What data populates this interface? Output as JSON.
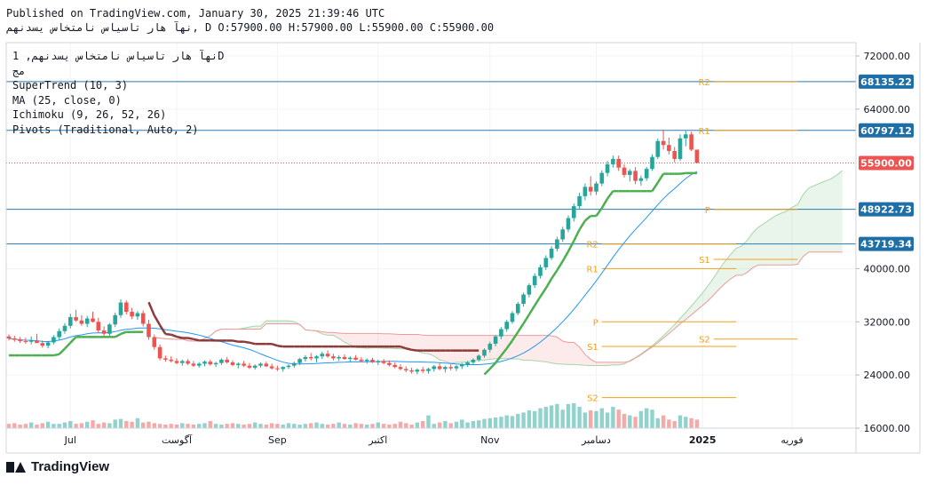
{
  "header": {
    "published": "Published on TradingView.com, January 30, 2025 21:39:46 UTC",
    "ohlc_line": "نهآ هار تاسیاس نامتخاس یسدنهم, D O:57900.00 H:57900.00 L:55900.00 C:55900.00"
  },
  "legend": {
    "symbol": "نهآ هار تاسیاس نامتخاس یسدنهم, 1D",
    "exchange": "مج",
    "supertrend": "SuperTrend (10, 3)",
    "ma": "MA (25, close, 0)",
    "ichimoku": "Ichimoku (9, 26, 52, 26)",
    "pivots": "Pivots (Traditional, Auto, 2)"
  },
  "brand": {
    "name": "TradingView"
  },
  "colors": {
    "up": "#26a69a",
    "down": "#ef5350",
    "supertrend_up": "#4caf50",
    "supertrend_down": "#8d3a3a",
    "ma": "#2196f3",
    "pivot": "#f59f1a",
    "hline": "#2a7ab0",
    "last_price": "#ef5350"
  },
  "chart_data": {
    "type": "candlestick",
    "x_ticks": [
      "Jul",
      "آگوست",
      "Sep",
      "اکتبر",
      "Nov",
      "دسامبر",
      "2025",
      "فوریه"
    ],
    "y_ticks": [
      "72000.00",
      "64000.00",
      "40000.00",
      "32000.00",
      "24000.00",
      "16000.00"
    ],
    "ylim": [
      16000,
      74000
    ],
    "price_tags": [
      {
        "label": "68135.22",
        "value": 68135.22,
        "kind": "hline"
      },
      {
        "label": "60797.12",
        "value": 60797.12,
        "kind": "hline"
      },
      {
        "label": "55900.00",
        "value": 55900.0,
        "kind": "last"
      },
      {
        "label": "48922.73",
        "value": 48922.73,
        "kind": "hline"
      },
      {
        "label": "43719.34",
        "value": 43719.34,
        "kind": "hline"
      }
    ],
    "pivot_sets": [
      {
        "from": "دسامبر",
        "levels": [
          {
            "label": "R2",
            "value": 43700
          },
          {
            "label": "R1",
            "value": 40000
          },
          {
            "label": "P",
            "value": 32000
          },
          {
            "label": "S1",
            "value": 28300
          },
          {
            "label": "S2",
            "value": 20600
          }
        ]
      },
      {
        "from": "2025",
        "levels": [
          {
            "label": "R2",
            "value": 68100
          },
          {
            "label": "R1",
            "value": 60800
          },
          {
            "label": "P",
            "value": 48900
          },
          {
            "label": "S1",
            "value": 41400
          },
          {
            "label": "S2",
            "value": 29400
          }
        ]
      }
    ],
    "candles": [
      {
        "o": 29800,
        "h": 30100,
        "l": 29200,
        "c": 29500
      },
      {
        "o": 29500,
        "h": 29900,
        "l": 29000,
        "c": 29300
      },
      {
        "o": 29300,
        "h": 29700,
        "l": 28800,
        "c": 29100
      },
      {
        "o": 29100,
        "h": 29600,
        "l": 28700,
        "c": 29000
      },
      {
        "o": 29000,
        "h": 29800,
        "l": 28600,
        "c": 29200
      },
      {
        "o": 29200,
        "h": 30200,
        "l": 28900,
        "c": 28800
      },
      {
        "o": 28800,
        "h": 29200,
        "l": 28100,
        "c": 28400
      },
      {
        "o": 28400,
        "h": 29000,
        "l": 28000,
        "c": 28900
      },
      {
        "o": 28900,
        "h": 30000,
        "l": 28600,
        "c": 29700
      },
      {
        "o": 29700,
        "h": 31000,
        "l": 29300,
        "c": 30600
      },
      {
        "o": 30600,
        "h": 31800,
        "l": 30200,
        "c": 31400
      },
      {
        "o": 31400,
        "h": 33200,
        "l": 31000,
        "c": 32700
      },
      {
        "o": 32700,
        "h": 33800,
        "l": 32000,
        "c": 32200
      },
      {
        "o": 32200,
        "h": 33000,
        "l": 31400,
        "c": 31700
      },
      {
        "o": 31700,
        "h": 32900,
        "l": 31200,
        "c": 32500
      },
      {
        "o": 32500,
        "h": 33500,
        "l": 31900,
        "c": 32000
      },
      {
        "o": 32000,
        "h": 32600,
        "l": 30300,
        "c": 30700
      },
      {
        "o": 30700,
        "h": 31300,
        "l": 29800,
        "c": 30200
      },
      {
        "o": 30200,
        "h": 31800,
        "l": 29800,
        "c": 31600
      },
      {
        "o": 31600,
        "h": 33400,
        "l": 31200,
        "c": 33000
      },
      {
        "o": 33000,
        "h": 35400,
        "l": 32600,
        "c": 34900
      },
      {
        "o": 34900,
        "h": 35200,
        "l": 33100,
        "c": 33500
      },
      {
        "o": 33500,
        "h": 34100,
        "l": 32400,
        "c": 32800
      },
      {
        "o": 32800,
        "h": 33600,
        "l": 32300,
        "c": 33300
      },
      {
        "o": 33300,
        "h": 33700,
        "l": 31300,
        "c": 31700
      },
      {
        "o": 31700,
        "h": 32300,
        "l": 29300,
        "c": 29700
      },
      {
        "o": 29700,
        "h": 30100,
        "l": 27800,
        "c": 28200
      },
      {
        "o": 28200,
        "h": 28600,
        "l": 26200,
        "c": 26500
      },
      {
        "o": 26500,
        "h": 26900,
        "l": 26000,
        "c": 26300
      },
      {
        "o": 26300,
        "h": 26800,
        "l": 25900,
        "c": 26100
      },
      {
        "o": 26100,
        "h": 26500,
        "l": 25600,
        "c": 25800
      },
      {
        "o": 25800,
        "h": 26300,
        "l": 25400,
        "c": 26100
      },
      {
        "o": 26100,
        "h": 26400,
        "l": 25500,
        "c": 25700
      },
      {
        "o": 25700,
        "h": 26100,
        "l": 25200,
        "c": 25400
      },
      {
        "o": 25400,
        "h": 25900,
        "l": 25100,
        "c": 25700
      },
      {
        "o": 25700,
        "h": 26200,
        "l": 25300,
        "c": 26000
      },
      {
        "o": 26000,
        "h": 26300,
        "l": 25400,
        "c": 25600
      },
      {
        "o": 25600,
        "h": 26000,
        "l": 25200,
        "c": 25800
      },
      {
        "o": 25800,
        "h": 26500,
        "l": 25500,
        "c": 26300
      },
      {
        "o": 26300,
        "h": 26700,
        "l": 25700,
        "c": 25900
      },
      {
        "o": 25900,
        "h": 26200,
        "l": 25300,
        "c": 25500
      },
      {
        "o": 25500,
        "h": 25900,
        "l": 25000,
        "c": 25700
      },
      {
        "o": 25700,
        "h": 26100,
        "l": 25200,
        "c": 25400
      },
      {
        "o": 25400,
        "h": 25800,
        "l": 24900,
        "c": 25100
      },
      {
        "o": 25100,
        "h": 25600,
        "l": 24800,
        "c": 25400
      },
      {
        "o": 25400,
        "h": 25900,
        "l": 25100,
        "c": 25700
      },
      {
        "o": 25700,
        "h": 26000,
        "l": 25200,
        "c": 25300
      },
      {
        "o": 25300,
        "h": 25700,
        "l": 24800,
        "c": 25000
      },
      {
        "o": 25000,
        "h": 25400,
        "l": 24600,
        "c": 24900
      },
      {
        "o": 24900,
        "h": 25300,
        "l": 24500,
        "c": 25200
      },
      {
        "o": 25200,
        "h": 25600,
        "l": 24900,
        "c": 25400
      },
      {
        "o": 25400,
        "h": 26000,
        "l": 25100,
        "c": 25800
      },
      {
        "o": 25800,
        "h": 26600,
        "l": 25500,
        "c": 26400
      },
      {
        "o": 26400,
        "h": 27000,
        "l": 26000,
        "c": 26700
      },
      {
        "o": 26700,
        "h": 27300,
        "l": 26200,
        "c": 26500
      },
      {
        "o": 26500,
        "h": 27000,
        "l": 25900,
        "c": 26800
      },
      {
        "o": 26800,
        "h": 27500,
        "l": 26400,
        "c": 27200
      },
      {
        "o": 27200,
        "h": 27700,
        "l": 26600,
        "c": 26800
      },
      {
        "o": 26800,
        "h": 27200,
        "l": 26200,
        "c": 26500
      },
      {
        "o": 26500,
        "h": 27000,
        "l": 26100,
        "c": 26700
      },
      {
        "o": 26700,
        "h": 27100,
        "l": 26300,
        "c": 26400
      },
      {
        "o": 26400,
        "h": 26800,
        "l": 26000,
        "c": 26600
      },
      {
        "o": 26600,
        "h": 27000,
        "l": 26200,
        "c": 26300
      },
      {
        "o": 26300,
        "h": 26700,
        "l": 25900,
        "c": 26100
      },
      {
        "o": 26100,
        "h": 26500,
        "l": 25700,
        "c": 26300
      },
      {
        "o": 26300,
        "h": 26600,
        "l": 25800,
        "c": 25900
      },
      {
        "o": 25900,
        "h": 26300,
        "l": 25500,
        "c": 26100
      },
      {
        "o": 26100,
        "h": 26400,
        "l": 25600,
        "c": 25800
      },
      {
        "o": 25800,
        "h": 26200,
        "l": 25300,
        "c": 25500
      },
      {
        "o": 25500,
        "h": 25900,
        "l": 25000,
        "c": 25200
      },
      {
        "o": 25200,
        "h": 25600,
        "l": 24700,
        "c": 24900
      },
      {
        "o": 24900,
        "h": 25300,
        "l": 24400,
        "c": 24700
      },
      {
        "o": 24700,
        "h": 25100,
        "l": 24200,
        "c": 24500
      },
      {
        "o": 24500,
        "h": 25000,
        "l": 24100,
        "c": 24800
      },
      {
        "o": 24800,
        "h": 25200,
        "l": 24300,
        "c": 24600
      },
      {
        "o": 24600,
        "h": 25100,
        "l": 24200,
        "c": 24900
      },
      {
        "o": 24900,
        "h": 25500,
        "l": 24500,
        "c": 25300
      },
      {
        "o": 25300,
        "h": 25800,
        "l": 24700,
        "c": 24900
      },
      {
        "o": 24900,
        "h": 25400,
        "l": 24400,
        "c": 25200
      },
      {
        "o": 25200,
        "h": 25600,
        "l": 24700,
        "c": 25000
      },
      {
        "o": 25000,
        "h": 25500,
        "l": 24600,
        "c": 25300
      },
      {
        "o": 25300,
        "h": 25800,
        "l": 24900,
        "c": 25600
      },
      {
        "o": 25600,
        "h": 26100,
        "l": 25200,
        "c": 25900
      },
      {
        "o": 25900,
        "h": 26500,
        "l": 25500,
        "c": 26300
      },
      {
        "o": 26300,
        "h": 27100,
        "l": 26000,
        "c": 26900
      },
      {
        "o": 26900,
        "h": 28000,
        "l": 26600,
        "c": 27800
      },
      {
        "o": 27800,
        "h": 29000,
        "l": 27400,
        "c": 28700
      },
      {
        "o": 28700,
        "h": 30000,
        "l": 28300,
        "c": 29800
      },
      {
        "o": 29800,
        "h": 31200,
        "l": 29400,
        "c": 30900
      },
      {
        "o": 30900,
        "h": 32300,
        "l": 30500,
        "c": 32000
      },
      {
        "o": 32000,
        "h": 33600,
        "l": 31700,
        "c": 33300
      },
      {
        "o": 33300,
        "h": 35000,
        "l": 33000,
        "c": 34700
      },
      {
        "o": 34700,
        "h": 36400,
        "l": 34300,
        "c": 36100
      },
      {
        "o": 36100,
        "h": 37800,
        "l": 35700,
        "c": 37500
      },
      {
        "o": 37500,
        "h": 39300,
        "l": 37100,
        "c": 38900
      },
      {
        "o": 38900,
        "h": 40600,
        "l": 38500,
        "c": 40200
      },
      {
        "o": 40200,
        "h": 42000,
        "l": 39800,
        "c": 41600
      },
      {
        "o": 41600,
        "h": 43400,
        "l": 41300,
        "c": 43000
      },
      {
        "o": 43000,
        "h": 44800,
        "l": 42600,
        "c": 44400
      },
      {
        "o": 44400,
        "h": 46300,
        "l": 44000,
        "c": 45900
      },
      {
        "o": 45900,
        "h": 48000,
        "l": 45500,
        "c": 47600
      },
      {
        "o": 47600,
        "h": 49800,
        "l": 47100,
        "c": 49400
      },
      {
        "o": 49400,
        "h": 51400,
        "l": 48900,
        "c": 50900
      },
      {
        "o": 50900,
        "h": 52800,
        "l": 50300,
        "c": 52300
      },
      {
        "o": 52300,
        "h": 53900,
        "l": 51000,
        "c": 51600
      },
      {
        "o": 51600,
        "h": 53100,
        "l": 51100,
        "c": 52800
      },
      {
        "o": 52800,
        "h": 54800,
        "l": 52400,
        "c": 54400
      },
      {
        "o": 54400,
        "h": 56200,
        "l": 53900,
        "c": 55700
      },
      {
        "o": 55700,
        "h": 57000,
        "l": 55200,
        "c": 56500
      },
      {
        "o": 56500,
        "h": 57000,
        "l": 54700,
        "c": 55200
      },
      {
        "o": 55200,
        "h": 55700,
        "l": 53700,
        "c": 54100
      },
      {
        "o": 54100,
        "h": 55000,
        "l": 53100,
        "c": 54700
      },
      {
        "o": 54700,
        "h": 55300,
        "l": 52700,
        "c": 53200
      },
      {
        "o": 53200,
        "h": 54000,
        "l": 52500,
        "c": 53600
      },
      {
        "o": 53600,
        "h": 55300,
        "l": 53200,
        "c": 55000
      },
      {
        "o": 55000,
        "h": 57200,
        "l": 54700,
        "c": 56800
      },
      {
        "o": 56800,
        "h": 59600,
        "l": 56500,
        "c": 59200
      },
      {
        "o": 59200,
        "h": 60900,
        "l": 57900,
        "c": 58600
      },
      {
        "o": 58600,
        "h": 59700,
        "l": 57200,
        "c": 57700
      },
      {
        "o": 57700,
        "h": 58300,
        "l": 56000,
        "c": 56500
      },
      {
        "o": 56500,
        "h": 60200,
        "l": 56200,
        "c": 59600
      },
      {
        "o": 59600,
        "h": 60700,
        "l": 58400,
        "c": 60200
      },
      {
        "o": 60200,
        "h": 60600,
        "l": 57700,
        "c": 57900
      },
      {
        "o": 57900,
        "h": 57900,
        "l": 55900,
        "c": 55900
      }
    ],
    "volume_ylim": [
      0,
      100
    ],
    "volumes": [
      6,
      7,
      5,
      6,
      8,
      5,
      7,
      9,
      6,
      6,
      8,
      10,
      6,
      7,
      9,
      11,
      6,
      8,
      7,
      12,
      13,
      10,
      9,
      14,
      8,
      9,
      7,
      6,
      5,
      6,
      5,
      7,
      6,
      5,
      6,
      7,
      10,
      6,
      5,
      6,
      7,
      6,
      5,
      6,
      8,
      6,
      5,
      7,
      6,
      5,
      7,
      6,
      5,
      6,
      7,
      8,
      6,
      5,
      6,
      8,
      6,
      5,
      7,
      6,
      5,
      6,
      8,
      6,
      5,
      6,
      9,
      7,
      5,
      8,
      10,
      18,
      6,
      8,
      10,
      7,
      9,
      12,
      8,
      10,
      11,
      13,
      14,
      15,
      16,
      18,
      17,
      20,
      22,
      25,
      24,
      28,
      30,
      32,
      34,
      26,
      34,
      35,
      30,
      22,
      25,
      24,
      28,
      22,
      30,
      26,
      20,
      18,
      16,
      24,
      28,
      26,
      14,
      18,
      12,
      10,
      18,
      16,
      14,
      12,
      10,
      9,
      8,
      12
    ]
  }
}
